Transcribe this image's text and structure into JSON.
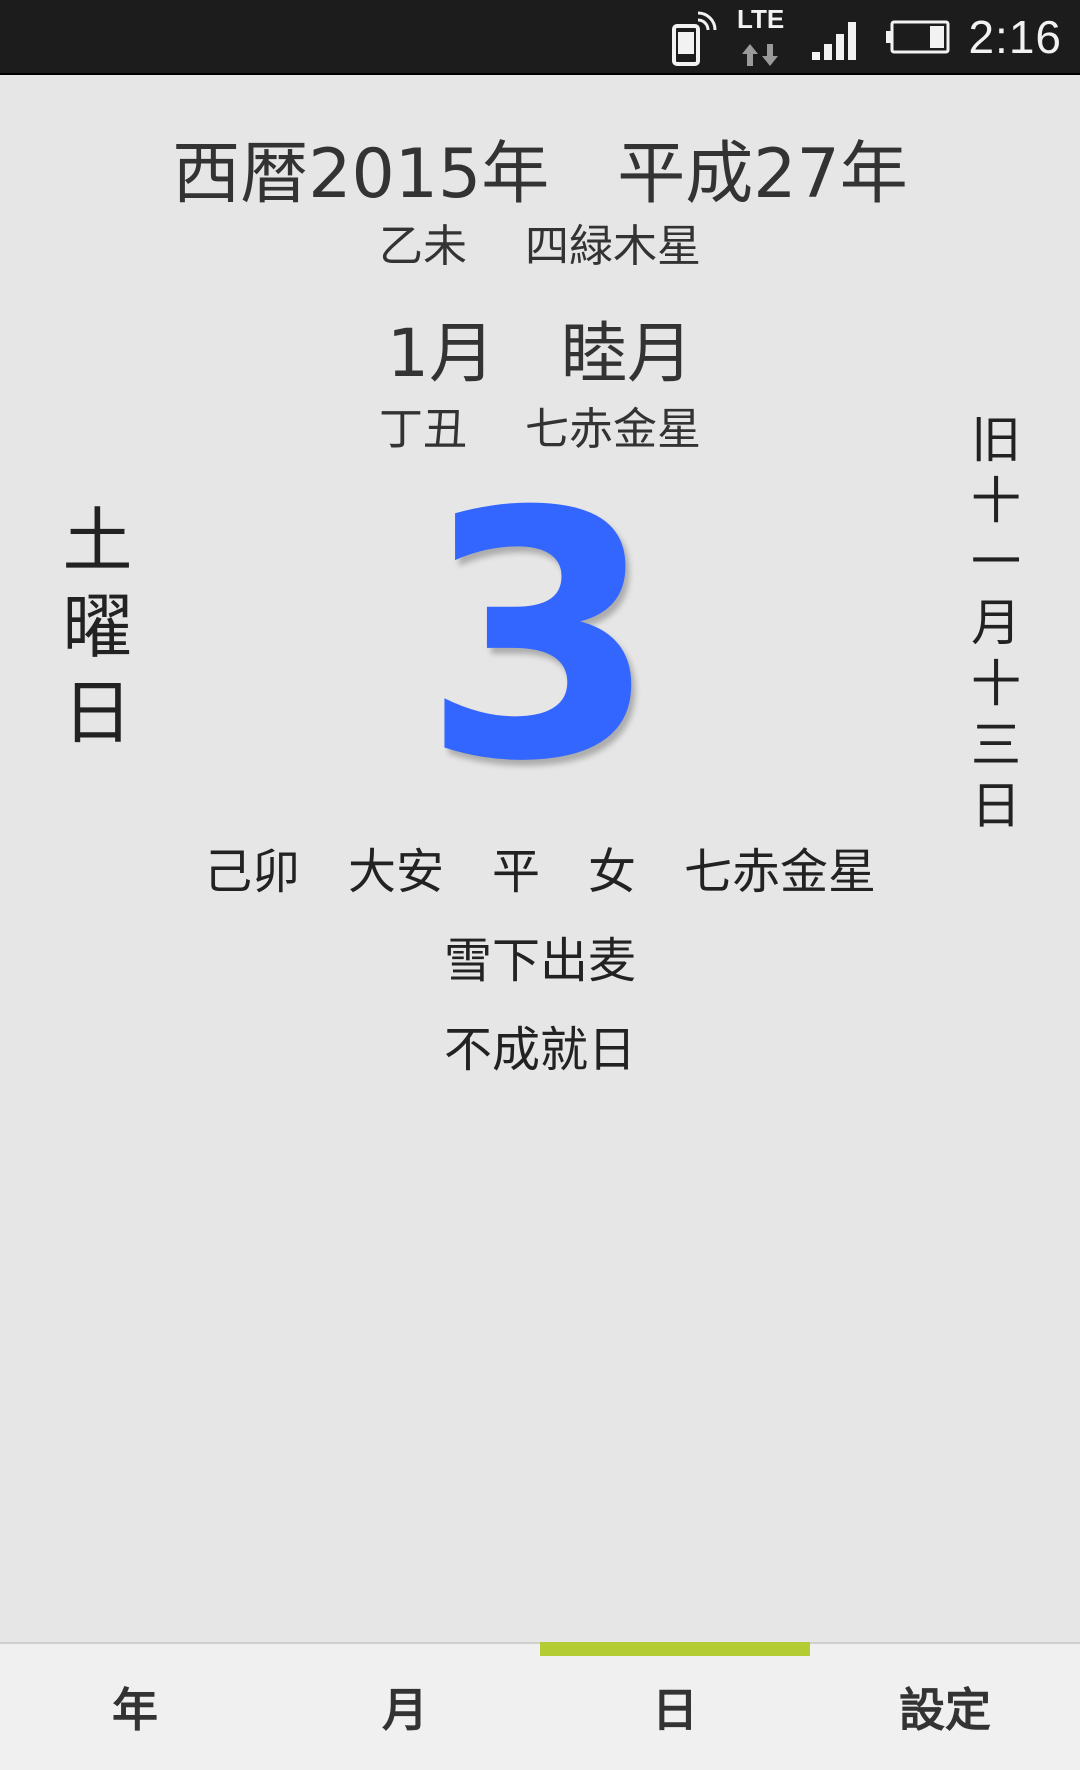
{
  "status_bar": {
    "network": "LTE",
    "time": "2:16"
  },
  "calendar": {
    "year_line": "西暦2015年　平成27年",
    "year_sub": "乙未　 四緑木星",
    "month_line": "1月　睦月",
    "month_sub": "丁丑　 七赤金星",
    "weekday": "土曜日",
    "old_date": "旧十一月十三日",
    "day_number": "3",
    "day_info": "己卯　大安　平　女　七赤金星",
    "seasonal": "雪下出麦",
    "fortune": "不成就日",
    "day_color": "#3366ff"
  },
  "tabs": [
    {
      "label": "年",
      "active": false
    },
    {
      "label": "月",
      "active": false
    },
    {
      "label": "日",
      "active": true
    },
    {
      "label": "設定",
      "active": false
    }
  ],
  "accent_color": "#b3cc33"
}
